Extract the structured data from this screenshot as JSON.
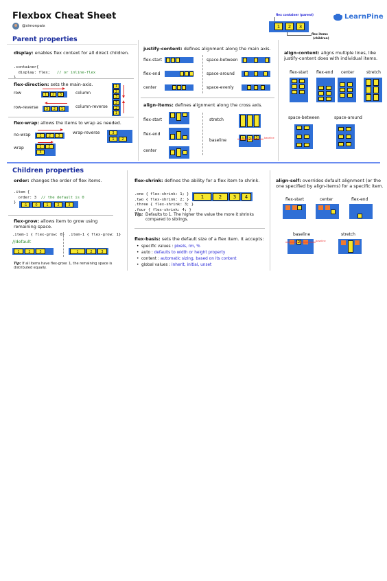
{
  "header": {
    "title": "Flexbox Cheat Sheet",
    "handle": "@simonpaix",
    "logo_text": "LearnPine",
    "diagram": {
      "container_label": "flex container (parent)",
      "items_label_1": "flex items",
      "items_label_2": "(children)",
      "items": [
        "1",
        "2",
        "3"
      ]
    }
  },
  "parent": {
    "heading": "Parent properties",
    "display": {
      "prop": "display:",
      "desc": " enables flex context for all direct children.",
      "code_1": ".container{",
      "code_2": "  display: flex;",
      "code_2_comment": "// or inline-flex",
      "code_3": "}"
    },
    "flex_direction": {
      "prop": "flex-direction:",
      "desc": " sets the main-axis.",
      "labels": [
        "row",
        "column",
        "row-reverse",
        "column-reverse"
      ]
    },
    "flex_wrap": {
      "prop": "flex-wrap:",
      "desc": " allows the items to wrap as needed.",
      "labels": [
        "no-wrap",
        "wrap-reverse",
        "wrap"
      ]
    },
    "justify_content": {
      "prop": "justify-content:",
      "desc": " defines alignment along the main axis.",
      "labels": [
        "flex-start",
        "space-between",
        "flex-end",
        "space-around",
        "center",
        "space-evenly"
      ]
    },
    "align_items": {
      "prop": "align-items:",
      "desc": " defines alignment along the cross axis.",
      "labels": [
        "flex-start",
        "stretch",
        "flex-end",
        "baseline",
        "center"
      ],
      "baseline_note": "baseline"
    },
    "align_content": {
      "prop": "align-content:",
      "desc": " aligns multiple lines, like justify-content does with individual items.",
      "labels": [
        "flex-start",
        "flex-end",
        "center",
        "stretch",
        "space-between",
        "space-around"
      ]
    }
  },
  "children": {
    "heading": "Children properties",
    "order": {
      "prop": "order:",
      "desc": " changes the order of flex items.",
      "code_1": ".item {",
      "code_2": "  order: 3",
      "code_2_comment": "// the default is 0",
      "code_3": "}",
      "items": [
        "-1",
        "0",
        "1",
        "2",
        "3"
      ]
    },
    "flex_grow": {
      "prop": "flex-grow:",
      "desc": " allows item to grow using remaining space.",
      "code_left": ".item-1 { flex-grow: 0}",
      "code_left_comment": "//default",
      "code_right": ".item-1 { flex-grow: 1}",
      "items": [
        "1",
        "2",
        "3"
      ],
      "tip_label": "Tip:",
      "tip": "If all items have flex-grow: 1, the remaining space is distributed equally."
    },
    "flex_shrink": {
      "prop": "flex-shrink:",
      "desc": " defines the ability for a flex item to shrink.",
      "code": [
        ".one { flex-shrink: 1; }",
        ".two { flex-shrink: 2; }",
        ".three { flex-shrink: 3; }",
        ".four { flex-shrink: 4; }"
      ],
      "items": [
        "1",
        "2",
        "3",
        "4"
      ],
      "tip_label": "Tip:",
      "tip": "Defaults to 1. The higher the value the more it shrinks compared to siblings."
    },
    "flex_basis": {
      "prop": "flex-basis:",
      "desc": " sets the default size of a flex item. It accepts:",
      "bullets": [
        {
          "label": "specific values  : ",
          "value": "pixels, rm, %"
        },
        {
          "label": "auto : ",
          "value": "defaults to width or height property"
        },
        {
          "label": "content : ",
          "value": "automatic sizing, based on its content"
        },
        {
          "label": "global values : ",
          "value": "inherit, initial, unset"
        }
      ]
    },
    "align_self": {
      "prop": "align-self:",
      "desc": " overrides default alignment (or the one specified by align-items) for a specific item.",
      "labels": [
        "flex-start",
        "center",
        "flex-end",
        "baseline",
        "stretch"
      ],
      "baseline_note": "baseline"
    }
  },
  "colors": {
    "container": "#2f6fd6",
    "item": "#f6e72c",
    "highlight": "#f07a2e",
    "heading": "#1a2d9e",
    "arrow": "#dd2222"
  }
}
